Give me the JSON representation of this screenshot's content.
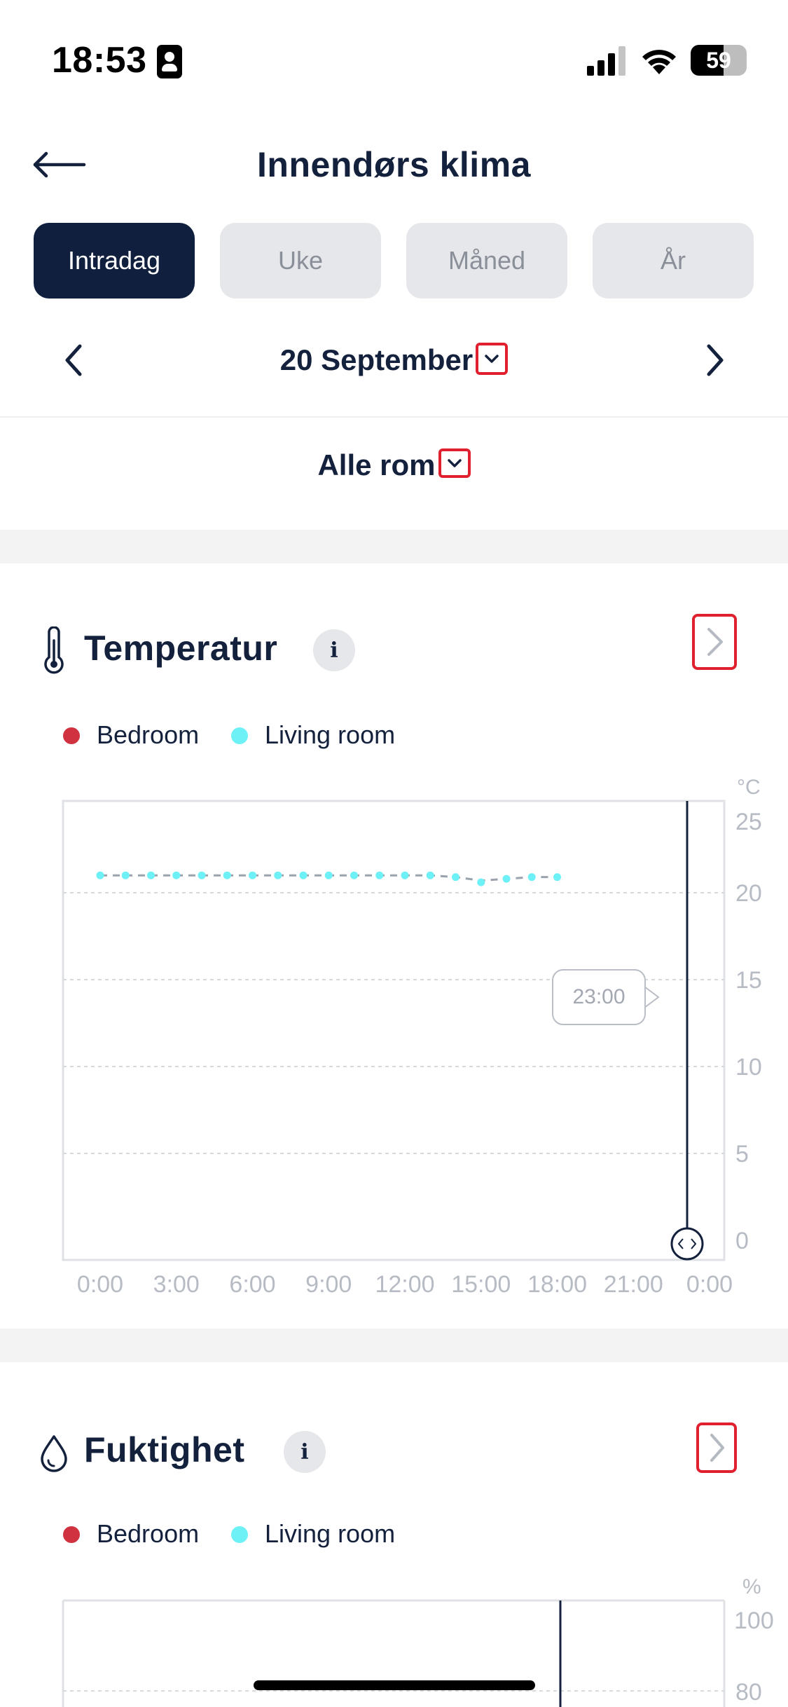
{
  "status_bar": {
    "time": "18:53",
    "battery": "59",
    "battery_level": 0.59
  },
  "header": {
    "title": "Innendørs klima",
    "back_icon": "arrow-left-icon"
  },
  "tabs": [
    {
      "label": "Intradag",
      "active": true
    },
    {
      "label": "Uke",
      "active": false
    },
    {
      "label": "Måned",
      "active": false
    },
    {
      "label": "År",
      "active": false
    }
  ],
  "date_nav": {
    "date": "20 September"
  },
  "room_filter": {
    "label": "Alle rom"
  },
  "temperature": {
    "title": "Temperatur",
    "info": "i",
    "legend": [
      {
        "name": "Bedroom",
        "color": "#d0323f"
      },
      {
        "name": "Living room",
        "color": "#6ef0f7"
      }
    ],
    "unit": "°C",
    "y_ticks": [
      "25",
      "20",
      "15",
      "10",
      "5",
      "0"
    ],
    "x_ticks": [
      "0:00",
      "3:00",
      "6:00",
      "9:00",
      "12:00",
      "15:00",
      "18:00",
      "21:00",
      "0:00"
    ],
    "tooltip": "23:00"
  },
  "humidity": {
    "title": "Fuktighet",
    "info": "i",
    "legend": [
      {
        "name": "Bedroom",
        "color": "#d0323f"
      },
      {
        "name": "Living room",
        "color": "#6ef0f7"
      }
    ],
    "unit": "%",
    "y_ticks": [
      "100",
      "80"
    ]
  },
  "chart_data": [
    {
      "type": "line",
      "title": "Temperatur",
      "ylabel": "°C",
      "ylim": [
        0,
        25
      ],
      "x_ticks": [
        "0:00",
        "3:00",
        "6:00",
        "9:00",
        "12:00",
        "15:00",
        "18:00",
        "21:00",
        "0:00"
      ],
      "x": [
        0,
        1,
        2,
        3,
        4,
        5,
        6,
        7,
        8,
        9,
        10,
        11,
        12,
        13,
        14,
        15,
        16,
        17,
        18
      ],
      "series": [
        {
          "name": "Living room",
          "values": [
            21.0,
            21.0,
            21.0,
            21.0,
            21.0,
            21.0,
            21.0,
            21.0,
            21.0,
            21.0,
            21.0,
            21.0,
            21.0,
            21.0,
            20.9,
            20.6,
            20.8,
            20.9,
            20.9
          ]
        },
        {
          "name": "Bedroom",
          "values": [
            21.0,
            21.0,
            21.0,
            21.0,
            21.0,
            21.0,
            21.0,
            21.0,
            21.0,
            21.0,
            21.0,
            21.0,
            21.0,
            21.0,
            20.9,
            20.7,
            20.8,
            20.9,
            20.9
          ]
        }
      ],
      "cursor_time": "23:00",
      "grid": true,
      "legend": "top-left"
    },
    {
      "type": "line",
      "title": "Fuktighet",
      "ylabel": "%",
      "y_ticks": [
        100,
        80
      ],
      "series": [
        {
          "name": "Bedroom",
          "values": []
        },
        {
          "name": "Living room",
          "values": []
        }
      ],
      "grid": true,
      "legend": "top-left"
    }
  ]
}
